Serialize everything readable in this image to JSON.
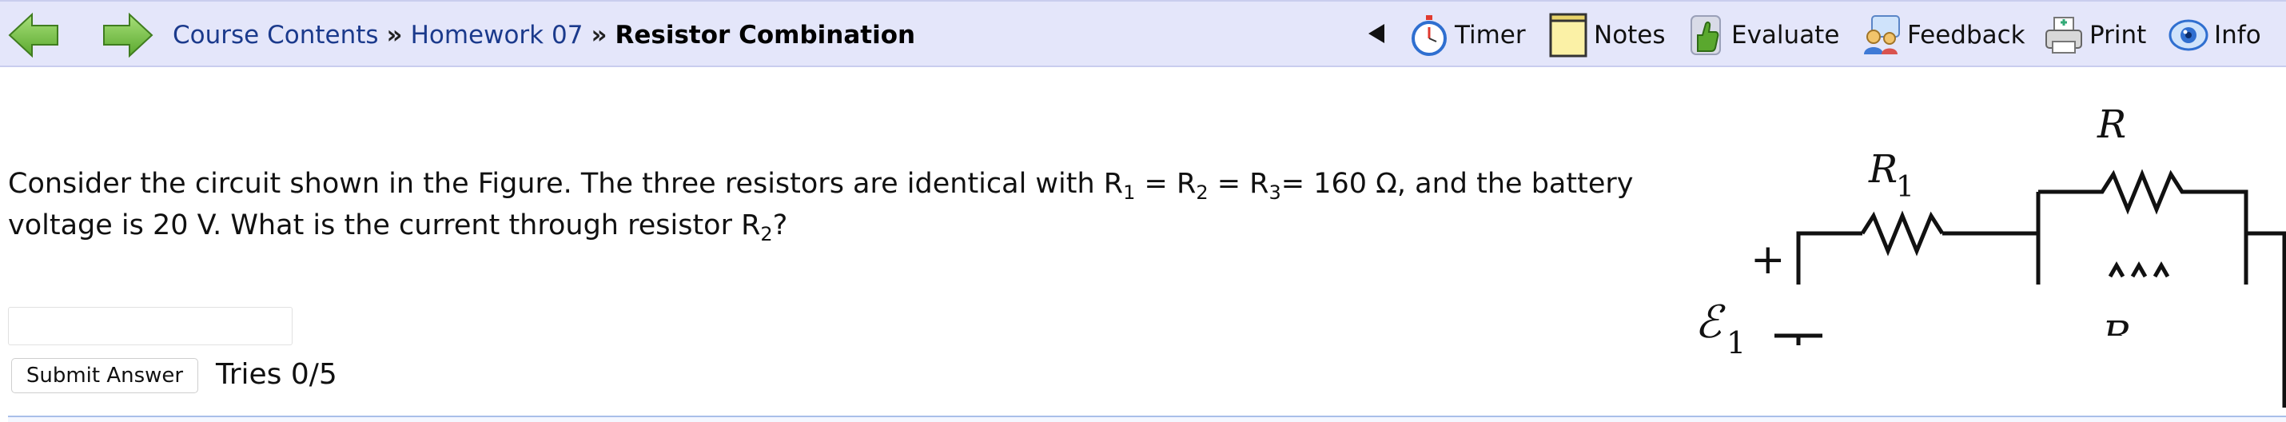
{
  "nav": {
    "crumbs": [
      {
        "label": "Course Contents",
        "link": true
      },
      {
        "label": "Homework 07",
        "link": true
      },
      {
        "label": "Resistor Combination",
        "link": false
      }
    ],
    "separator": "»"
  },
  "toolbar": {
    "timer_label": "Timer",
    "notes_label": "Notes",
    "evaluate_label": "Evaluate",
    "feedback_label": "Feedback",
    "print_label": "Print",
    "info_label": "Info"
  },
  "question": {
    "part1": "Consider the circuit shown in the Figure. The three resistors are identical with R",
    "sub1": "1",
    "part2": " = R",
    "sub2": "2",
    "part3": " = R",
    "sub3": "3",
    "part4": "= 160 Ω, and the battery voltage is 20 V. What is the current through resistor R",
    "sub4": "2",
    "part5": "?"
  },
  "answer": {
    "value": "",
    "submit_label": "Submit Answer",
    "tries_label": "Tries 0/5"
  },
  "figure": {
    "r1_letter": "R",
    "r1_sub": "1",
    "r2_letter": "R",
    "r3_letter": "R",
    "emf_letter": "ℰ",
    "emf_sub": "1",
    "plus": "+"
  },
  "colors": {
    "topbar_bg": "#e4e6fa",
    "link": "#1b3a8c",
    "arrow_green": "#7dc84a"
  }
}
